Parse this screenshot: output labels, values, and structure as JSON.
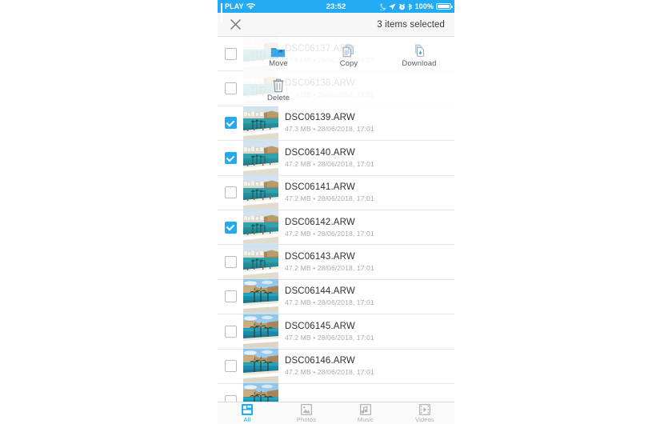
{
  "status_bar": {
    "carrier": "PLAY",
    "time": "23:52",
    "battery_percent": "100%",
    "icons": [
      "signal-bars-icon",
      "wifi-icon",
      "moon-icon",
      "location-arrow-icon",
      "alarm-clock-icon",
      "bluetooth-icon",
      "battery-icon"
    ],
    "background": "#22aaf2"
  },
  "action_bar": {
    "close_icon": "close-icon",
    "selection_label": "3 items selected"
  },
  "overlay_actions": [
    {
      "label": "Move",
      "icon": "folder-move-icon"
    },
    {
      "label": "Copy",
      "icon": "copy-documents-icon"
    },
    {
      "label": "Download",
      "icon": "download-document-icon"
    },
    {
      "label": "Delete",
      "icon": "trash-icon"
    }
  ],
  "files": [
    {
      "name": "DSC06137.ARW",
      "size": "47.6 MB",
      "date": "28/06/2018, 16:57",
      "selected": false,
      "thumb": "coast-town"
    },
    {
      "name": "DSC06138.ARW",
      "size": "47.3 MB",
      "date": "28/06/2018, 17:01",
      "selected": false,
      "thumb": "coast-town"
    },
    {
      "name": "DSC06139.ARW",
      "size": "47.3 MB",
      "date": "28/06/2018, 17:01",
      "selected": true,
      "thumb": "coast-town"
    },
    {
      "name": "DSC06140.ARW",
      "size": "47.2 MB",
      "date": "28/06/2018, 17:01",
      "selected": true,
      "thumb": "coast-town"
    },
    {
      "name": "DSC06141.ARW",
      "size": "47.2 MB",
      "date": "28/06/2018, 17:01",
      "selected": false,
      "thumb": "coast-town"
    },
    {
      "name": "DSC06142.ARW",
      "size": "47.2 MB",
      "date": "28/06/2018, 17:01",
      "selected": true,
      "thumb": "coast-town"
    },
    {
      "name": "DSC06143.ARW",
      "size": "47.2 MB",
      "date": "28/06/2018, 17:01",
      "selected": false,
      "thumb": "coast-town"
    },
    {
      "name": "DSC06144.ARW",
      "size": "47.2 MB",
      "date": "28/06/2018, 17:01",
      "selected": false,
      "thumb": "coast-palms"
    },
    {
      "name": "DSC06145.ARW",
      "size": "47.2 MB",
      "date": "28/06/2018, 17:01",
      "selected": false,
      "thumb": "coast-palms"
    },
    {
      "name": "DSC06146.ARW",
      "size": "47.2 MB",
      "date": "28/06/2018, 17:01",
      "selected": false,
      "thumb": "coast-palms"
    },
    {
      "name": "",
      "size": "",
      "date": "",
      "selected": false,
      "thumb": "coast-palms"
    }
  ],
  "separator": " • ",
  "tabs": [
    {
      "label": "All",
      "icon": "grid-layout-icon",
      "active": true
    },
    {
      "label": "Photos",
      "icon": "photo-icon",
      "active": false
    },
    {
      "label": "Music",
      "icon": "music-note-icon",
      "active": false
    },
    {
      "label": "Videos",
      "icon": "film-strip-icon",
      "active": false
    }
  ],
  "colors": {
    "accent": "#22aaf2",
    "text": "#2b3238",
    "subtext": "#a8acaf"
  }
}
